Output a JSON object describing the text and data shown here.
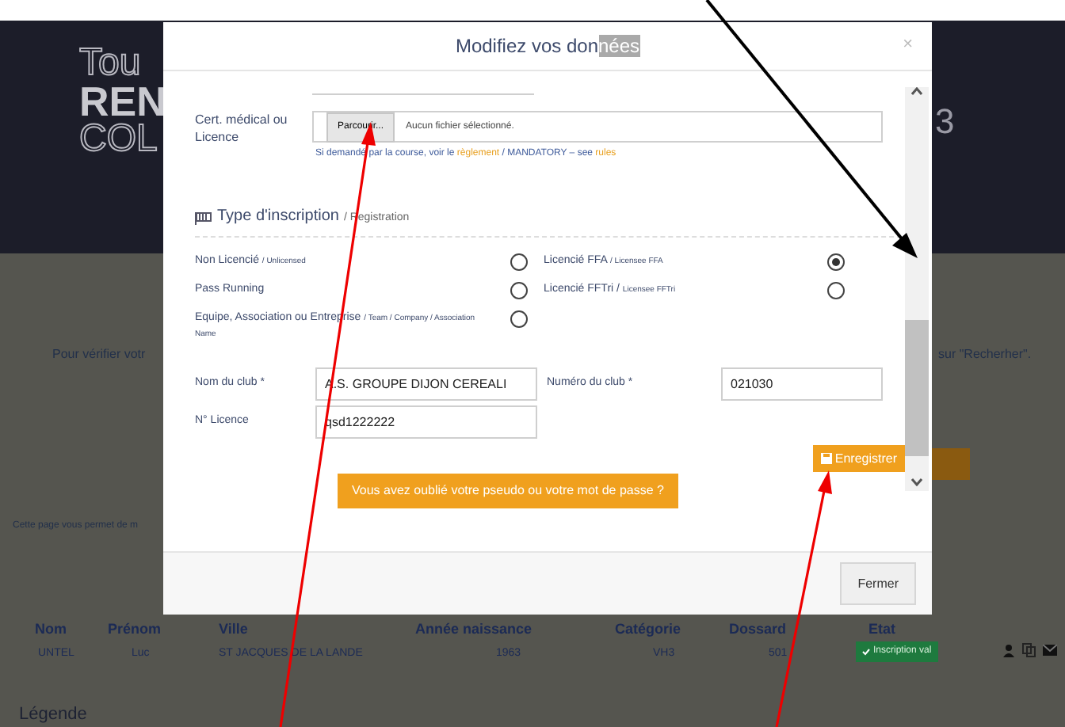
{
  "page": {
    "logo_lines": [
      "Tou",
      "REN",
      "COL"
    ],
    "header_mark": "3",
    "intro_left": "Pour vérifier votr",
    "intro_right": "sur \"Recherher\".",
    "note": "Cette page vous permet de m",
    "table": {
      "columns": [
        "Nom",
        "Prénom",
        "Ville",
        "Année naissance",
        "Catégorie",
        "Dossard",
        "Etat"
      ],
      "rows": [
        {
          "cells": [
            "UNTEL",
            "Luc",
            "ST JACQUES DE LA LANDE",
            "1963",
            "VH3",
            "501"
          ],
          "status": "Inscription val"
        }
      ]
    },
    "legend": "Légende"
  },
  "modal": {
    "title": "Modifiez vos don",
    "title_selected": "nées",
    "close": "×",
    "certificate": {
      "label": "Cert. médical ou Licence",
      "button": "Parcourir...",
      "file": "Aucun fichier sélectionné.",
      "help_start": "Si demandé par la course, voir le",
      "help_link": "règlement",
      "help_middle": "/ MANDATORY – see",
      "help_link_2": "rules"
    },
    "section": {
      "title": "Type d'inscription",
      "subtitle": "/ Registration"
    },
    "options": [
      {
        "label": "Non Licencié",
        "sub": "/ Unlicensed",
        "selected": false
      },
      {
        "label": "Licencié FFA",
        "sub": "/ Licensee FFA",
        "selected": true
      },
      {
        "label": "Pass Running",
        "selected": false
      },
      {
        "label": "Licencié FFTri /",
        "sub": "Licensee FFTri",
        "selected": false
      },
      {
        "label": "Equipe, Association ou Entreprise",
        "sub": "/ Team / Company / Association Name",
        "selected": false
      }
    ],
    "club_name": {
      "label": "Nom du club *",
      "value": "A.S. GROUPE DIJON CEREALI"
    },
    "club_number": {
      "label": "Numéro du club *",
      "value": "021030"
    },
    "licence": {
      "label": "N° Licence",
      "value": "qsd1222222"
    },
    "save": "Enregistrer",
    "forgot": "Vous avez oublié votre pseudo ou votre mot de passe ?",
    "footer_button": "Fermer"
  }
}
